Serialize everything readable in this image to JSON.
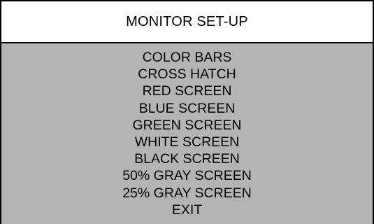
{
  "menu": {
    "title": "MONITOR SET-UP",
    "items": [
      {
        "label": "COLOR BARS"
      },
      {
        "label": "CROSS HATCH"
      },
      {
        "label": "RED SCREEN"
      },
      {
        "label": "BLUE SCREEN"
      },
      {
        "label": "GREEN SCREEN"
      },
      {
        "label": "WHITE SCREEN"
      },
      {
        "label": "BLACK SCREEN"
      },
      {
        "label": "50% GRAY SCREEN"
      },
      {
        "label": "25% GRAY SCREEN"
      },
      {
        "label": "EXIT"
      }
    ]
  },
  "colors": {
    "header_background": "#ffffff",
    "body_background": "#b4b4b4",
    "text": "#000000",
    "border": "#000000"
  }
}
